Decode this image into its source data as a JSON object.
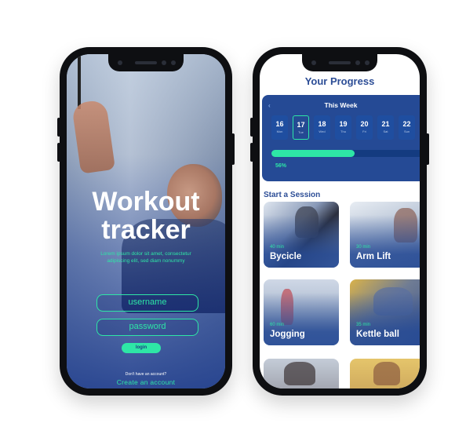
{
  "login": {
    "title_line1": "Workout",
    "title_line2": "tracker",
    "subtitle": "Lorem ipsum dolor sit amet, consectetur adipiscing elit, sed diam nonummy",
    "username_label": "username",
    "password_label": "password",
    "login_button": "login",
    "no_account_text": "Don't have an account?",
    "create_account_link": "Create an account"
  },
  "progress": {
    "title": "Your Progress",
    "week_label": "This Week",
    "back_arrow": "‹",
    "days": [
      {
        "num": "16",
        "name": "Mon"
      },
      {
        "num": "17",
        "name": "Tue"
      },
      {
        "num": "18",
        "name": "Wed"
      },
      {
        "num": "19",
        "name": "Thu"
      },
      {
        "num": "20",
        "name": "Fri"
      },
      {
        "num": "21",
        "name": "Sat"
      },
      {
        "num": "22",
        "name": "Sun"
      }
    ],
    "progress_percent_label": "56%",
    "progress_fraction": 0.56,
    "section_title": "Start a Session",
    "sessions": [
      {
        "duration": "40 min",
        "name": "Bycicle"
      },
      {
        "duration": "30 min",
        "name": "Arm Lift"
      },
      {
        "duration": "60 min",
        "name": "Jogging"
      },
      {
        "duration": "35 min",
        "name": "Kettle ball"
      }
    ]
  },
  "colors": {
    "accent": "#2ee6a6",
    "primary_blue": "#254a95",
    "title_blue": "#2c4d96"
  }
}
